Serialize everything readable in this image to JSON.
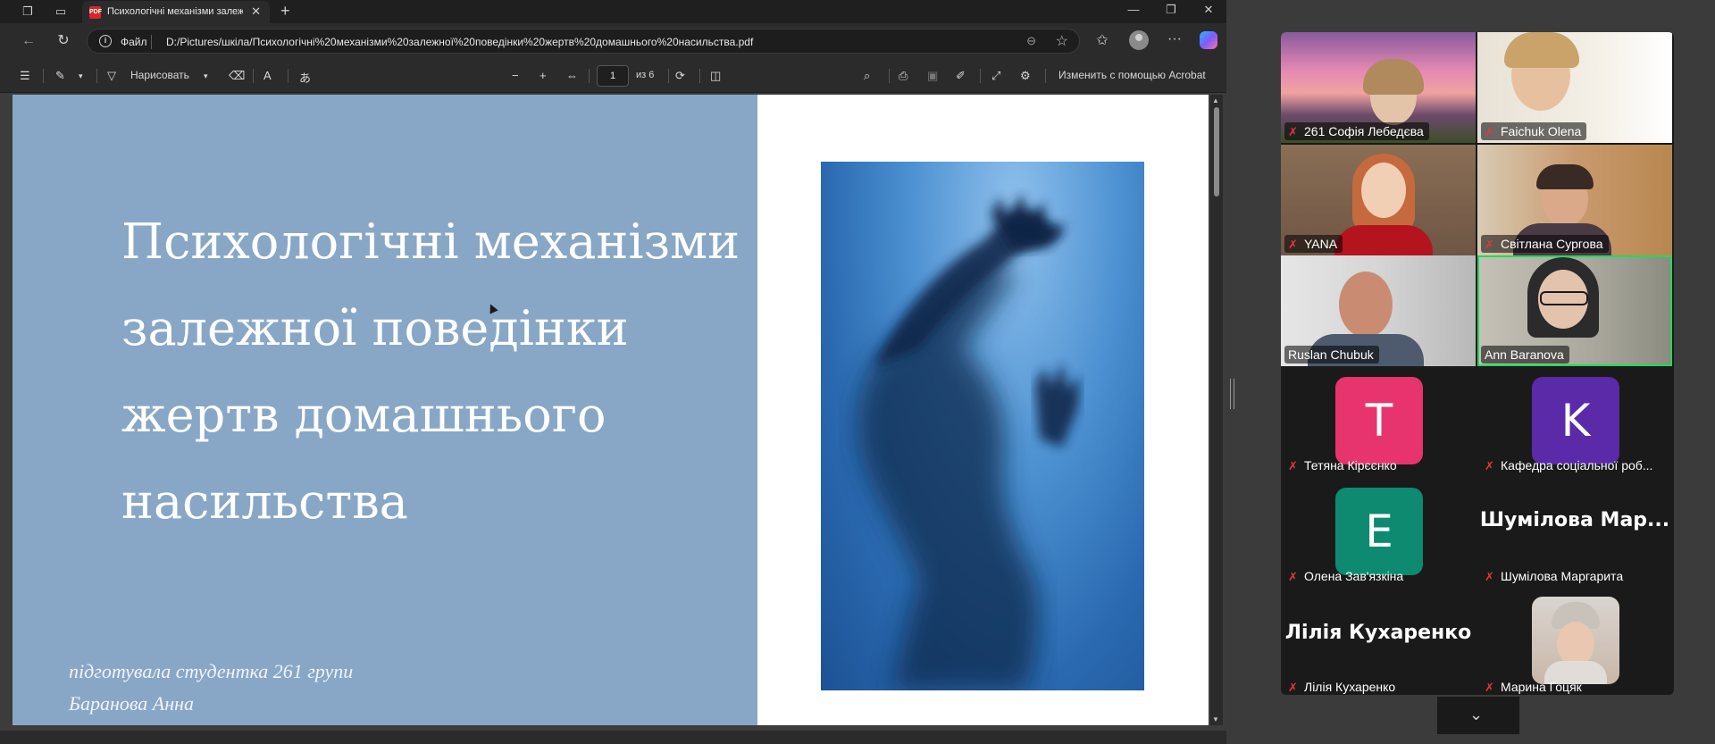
{
  "tab": {
    "title": "Психологічні механізми залежн"
  },
  "address": {
    "scheme_label": "Файл",
    "url": "D:/Pictures/шкіла/Психологічні%20механізми%20залежної%20поведінки%20жертв%20домашнього%20насильства.pdf"
  },
  "pdf_toolbar": {
    "draw_label": "Нарисовать",
    "page_current": "1",
    "page_total": "из 6",
    "acrobat_label": "Изменить с помощью Acrobat"
  },
  "slide": {
    "title_lines": [
      "Психологічні механізми",
      "залежної поведінки",
      "жертв домашнього",
      "насильства"
    ],
    "author_line1": "підготувала студентка 261 групи",
    "author_line2": "Баранова Анна",
    "panel_color": "#88a7c6"
  },
  "participants": [
    {
      "name": "261 Софія Лебедєва",
      "type": "video",
      "muted": true
    },
    {
      "name": "Faichuk Olena",
      "type": "video",
      "muted": true
    },
    {
      "name": "YANA",
      "type": "video",
      "muted": true
    },
    {
      "name": "Світлана Сургова",
      "type": "video",
      "muted": true
    },
    {
      "name": "Ruslan Chubuk",
      "type": "video",
      "muted": false
    },
    {
      "name": "Ann Baranova",
      "type": "video",
      "muted": false,
      "active_speaker": true
    },
    {
      "name": "Тетяна Кірєєнко",
      "type": "avatar",
      "initial": "T",
      "color": "#e8346e",
      "muted": true
    },
    {
      "name": "Кафедра соціальної роб...",
      "type": "avatar",
      "initial": "K",
      "color": "#5a2aa8",
      "muted": true
    },
    {
      "name": "Олена Зав'язкіна",
      "type": "avatar",
      "initial": "E",
      "color": "#0d8a6f",
      "muted": true
    },
    {
      "name": "Шумілова Маргарита",
      "type": "text",
      "display": "Шумілова Мар...",
      "muted": true
    },
    {
      "name": "Лілія Кухаренко",
      "type": "text",
      "display": "Лілія Кухаренко",
      "muted": true
    },
    {
      "name": "Марина Гоцяк",
      "type": "photo",
      "muted": true
    }
  ],
  "colors": {
    "active_border": "#23d959",
    "muted_icon": "#e0383e"
  }
}
